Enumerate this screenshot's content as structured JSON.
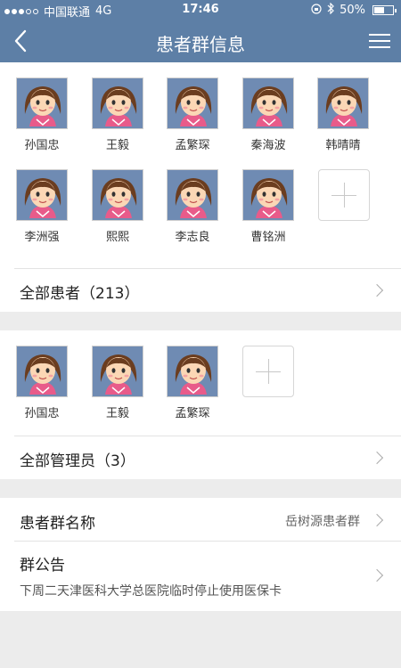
{
  "status": {
    "carrier": "中国联通",
    "network": "4G",
    "time": "17:46",
    "battery": "50%",
    "battery_level": 0.5
  },
  "nav": {
    "title": "患者群信息"
  },
  "patients": {
    "members": [
      "孙国忠",
      "王毅",
      "孟繁琛",
      "秦海波",
      "韩晴晴",
      "李洲强",
      "熙熙",
      "李志良",
      "曹铭洲"
    ],
    "all_label": "全部患者（213）"
  },
  "admins": {
    "members": [
      "孙国忠",
      "王毅",
      "孟繁琛"
    ],
    "all_label": "全部管理员（3）"
  },
  "group": {
    "name_label": "患者群名称",
    "name_value": "岳树源患者群",
    "notice_label": "群公告",
    "notice_text": "下周二天津医科大学总医院临时停止使用医保卡"
  },
  "icons": {
    "back": "chevron-left-icon",
    "menu": "hamburger-menu-icon",
    "add": "plus-icon",
    "more": "chevron-right-icon",
    "avatar": "girl-avatar-icon"
  },
  "colors": {
    "navbar": "#5d7fa6",
    "page_bg": "#ececec"
  }
}
